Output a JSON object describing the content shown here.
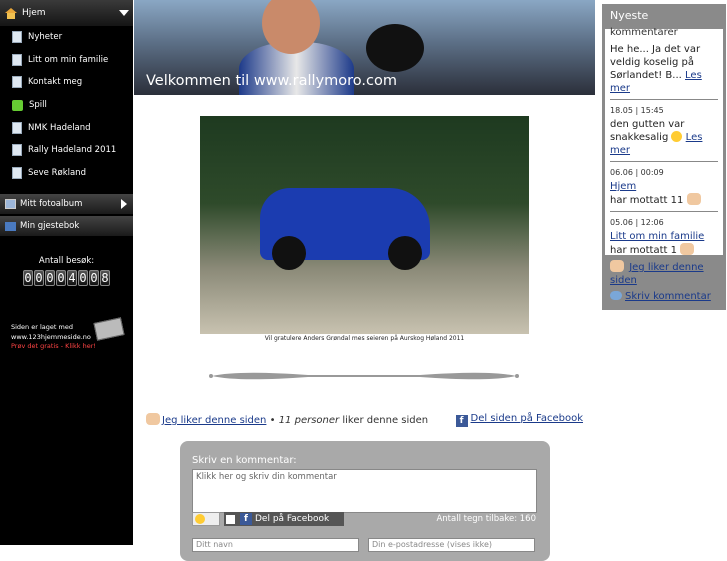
{
  "nav": {
    "home": "Hjem",
    "items": [
      {
        "label": "Nyheter",
        "icon": "page-icon"
      },
      {
        "label": "Litt om min familie",
        "icon": "page-icon"
      },
      {
        "label": "Kontakt meg",
        "icon": "page-icon"
      },
      {
        "label": "Spill",
        "icon": "puzzle-icon"
      },
      {
        "label": "NMK Hadeland",
        "icon": "page-icon"
      },
      {
        "label": "Rally Hadeland 2011",
        "icon": "page-icon"
      },
      {
        "label": "Seve Røkland",
        "icon": "page-icon"
      }
    ],
    "photo_album": "Mitt fotoalbum",
    "guestbook": "Min gjestebok"
  },
  "counter": {
    "label": "Antall besøk:",
    "digits": [
      "0",
      "0",
      "0",
      "0",
      "4",
      "0",
      "0",
      "8"
    ]
  },
  "made_with": {
    "line1": "Siden er laget med",
    "line2": "www.123hjemmeside.no",
    "cta": "Prøv det gratis - Klikk her!"
  },
  "header": {
    "welcome": "Velkommen til www.rallymoro.com"
  },
  "photo": {
    "caption": "Vil gratulere Anders Grøndal mes seieren på Aurskog Høland 2011"
  },
  "likes": {
    "like_link": "Jeg liker denne siden",
    "separator": "•",
    "count_text": "11 personer",
    "suffix": "liker denne siden",
    "share_fb": "Del siden på Facebook"
  },
  "comment_form": {
    "title": "Skriv en kommentar:",
    "placeholder": "Klikk her og skriv din kommentar",
    "fb_share": "Del på Facebook",
    "chars_left": "Antall tegn tilbake: 160",
    "name_placeholder": "Ditt navn",
    "email_placeholder": "Din e-postadresse (vises ikke)"
  },
  "sidebar_right": {
    "title": "Nyeste",
    "title_overlap": "kommentarer",
    "comment1_text": "He he... Ja det var veldig koselig på Sørlandet! B...",
    "comment1_more": "Les mer",
    "comment2_date": "18.05 | 15:45",
    "comment2_text": "den gutten var snakkesalig",
    "comment2_more": "Les mer",
    "comment3_date": "06.06 | 00:09",
    "comment3_link": "Hjem",
    "comment3_text": "har mottatt 11",
    "comment4_date": "05.06 | 12:06",
    "comment4_link": "Litt om min familie",
    "comment4_text": "har mottatt 1",
    "like_link": "Jeg liker denne siden",
    "write_comment": "Skriv kommentar"
  }
}
